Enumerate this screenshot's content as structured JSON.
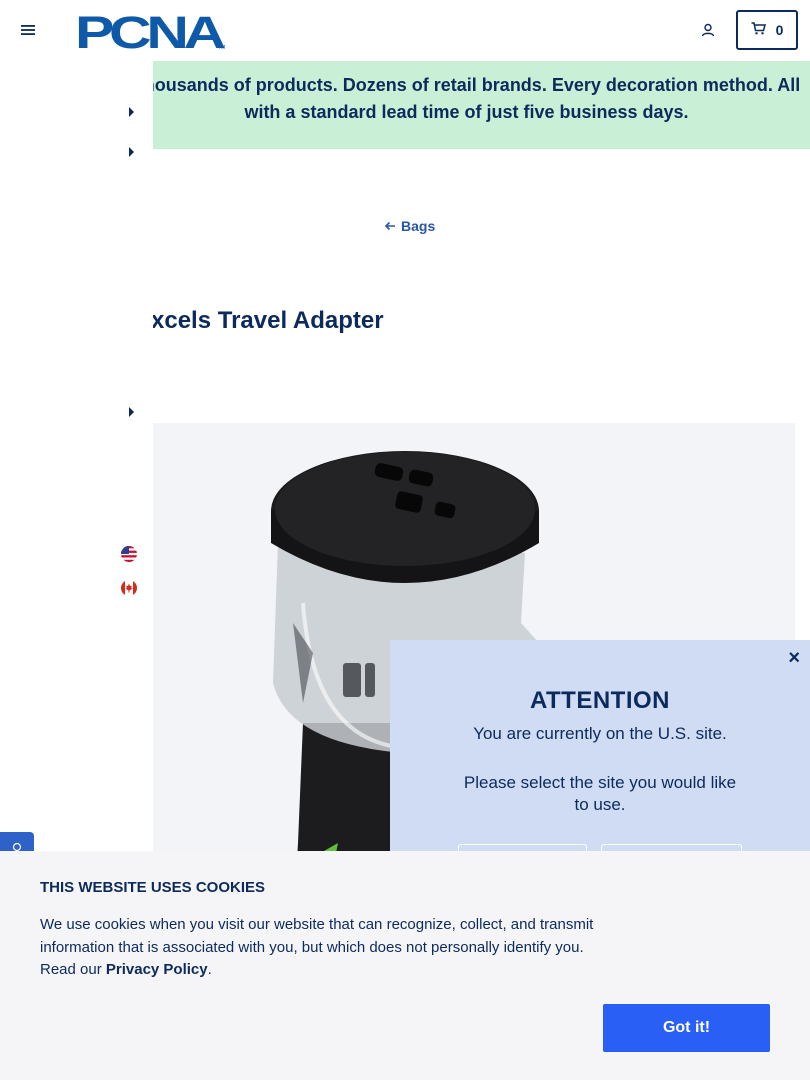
{
  "header": {
    "brand_name": "PCNA",
    "cart_count": "0"
  },
  "promo": {
    "text_line1": "Thousands of products. Dozens of retail brands. Every decoration method. All",
    "text_line2": "with a standard lead time of just five business days."
  },
  "breadcrumb": {
    "label": "Bags"
  },
  "product": {
    "title": "Excels Travel Adapter"
  },
  "site_modal": {
    "heading": "ATTENTION",
    "current_site": "You are currently on the U.S. site.",
    "prompt": "Please select the site you would like to use.",
    "close_glyph": "×"
  },
  "cookie_banner": {
    "title": "THIS WEBSITE USES COOKIES",
    "text_before_link": "We use cookies when you visit our website that can recognize, collect, and transmit information that is associated with you, but which does not personally identify you. Read our ",
    "link_label": "Privacy Policy",
    "text_after_link": ".",
    "accept_label": "Got it!"
  },
  "colors": {
    "navy": "#0c2a5b",
    "brand_blue": "#0f5aa8",
    "promo_bg": "#c9f0d6",
    "modal_bg": "#cfdcf3",
    "accept_button": "#2a5ff5"
  },
  "icons": [
    "hamburger-menu-icon",
    "account-icon",
    "cart-icon",
    "arrow-left-icon",
    "us-flag-icon",
    "canada-flag-icon",
    "close-icon"
  ]
}
